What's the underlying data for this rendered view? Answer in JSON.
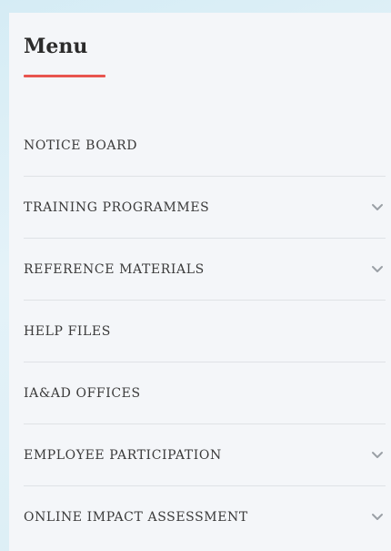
{
  "menu": {
    "title": "Menu",
    "accent_color": "#e8554f",
    "items": [
      {
        "label": "NOTICE BOARD",
        "has_submenu": false
      },
      {
        "label": "TRAINING PROGRAMMES",
        "has_submenu": true,
        "icon": "chevron-down-icon"
      },
      {
        "label": "REFERENCE MATERIALS",
        "has_submenu": true,
        "icon": "chevron-down-icon"
      },
      {
        "label": "HELP FILES",
        "has_submenu": false
      },
      {
        "label": "IA&AD OFFICES",
        "has_submenu": false
      },
      {
        "label": "EMPLOYEE PARTICIPATION",
        "has_submenu": true,
        "icon": "chevron-down-icon"
      },
      {
        "label": "ONLINE IMPACT ASSESSMENT",
        "has_submenu": true,
        "icon": "chevron-down-icon"
      }
    ]
  }
}
